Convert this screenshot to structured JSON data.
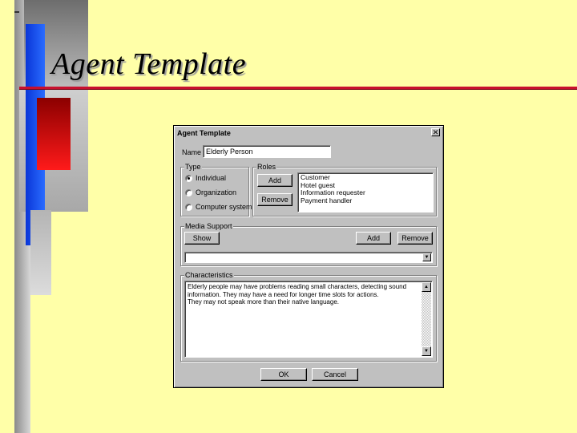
{
  "slide": {
    "title": "Agent Template"
  },
  "dialog": {
    "title": "Agent Template",
    "close_glyph": "✕",
    "name_label": "Name",
    "name_value": "Elderly Person",
    "type_group": {
      "label": "Type",
      "options": [
        "Individual",
        "Organization",
        "Computer system"
      ],
      "selected_index": 0
    },
    "roles_group": {
      "label": "Roles",
      "add_label": "Add",
      "remove_label": "Remove",
      "items": [
        "Customer",
        "Hotel guest",
        "Information requester",
        "Payment handler"
      ]
    },
    "media_group": {
      "label": "Media Support",
      "show_label": "Show",
      "add_label": "Add",
      "remove_label": "Remove",
      "combo_value": "",
      "combo_arrow": "▼"
    },
    "characteristics_group": {
      "label": "Characteristics",
      "lines": [
        "Elderly people may have problems reading small characters, detecting sound",
        "information. They may have a need for longer time slots for actions.",
        "They may not speak more than their native language."
      ],
      "scroll_up": "▲",
      "scroll_down": "▼"
    },
    "ok_label": "OK",
    "cancel_label": "Cancel"
  },
  "colors": {
    "slide_background": "#ffffa8",
    "accent_red": "#c8102e",
    "accent_blue": "#1a50f0",
    "dialog_face": "#c0c0c0"
  }
}
